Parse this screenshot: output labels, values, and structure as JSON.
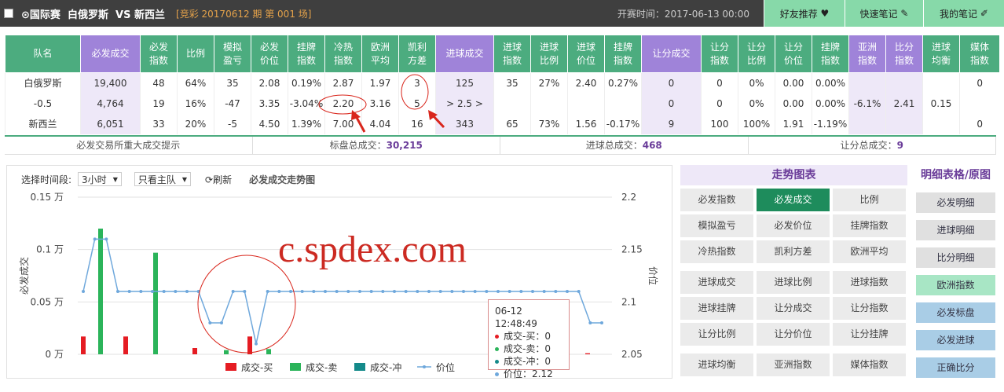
{
  "top": {
    "league": "⊙国际赛",
    "home": "白俄罗斯",
    "vs": "VS",
    "away": "新西兰",
    "issue": "[竞彩 20170612 期 第 001 场]",
    "open_time": "开赛时间：2017-06-13 00:00",
    "buttons": [
      "好友推荐",
      "快速笔记",
      "我的笔记"
    ]
  },
  "colors": {
    "header_green": "#4cac7f",
    "header_purple": "#9f83d9",
    "buy": "#e51c23",
    "sell": "#2bb45a",
    "hedge": "#148a8a",
    "price": "#6fa8dc"
  },
  "table": {
    "headers": [
      "队名",
      "必发成交",
      "必发指数",
      "比例",
      "模拟盈亏",
      "必发价位",
      "挂牌指数",
      "冷热指数",
      "欧洲平均",
      "凯利方差",
      "进球成交",
      "进球指数",
      "进球比例",
      "进球价位",
      "挂牌指数",
      "让分成交",
      "让分指数",
      "让分比例",
      "让分价位",
      "挂牌指数",
      "亚洲指数",
      "比分指数",
      "进球均衡",
      "媒体指数"
    ],
    "rows": [
      [
        "白俄罗斯",
        "19,400",
        "48",
        "64%",
        "35",
        "2.08",
        "0.19%",
        "2.87",
        "1.97",
        "3",
        "125",
        "35",
        "27%",
        "2.40",
        "0.27%",
        "0",
        "0",
        "0%",
        "0.00",
        "0.00%",
        "",
        "",
        "",
        "0"
      ],
      [
        "-0.5",
        "4,764",
        "19",
        "16%",
        "-47",
        "3.35",
        "-3.04%",
        "2.20",
        "3.16",
        "5",
        "> 2.5 >",
        "",
        "",
        "",
        "",
        "0",
        "0",
        "0%",
        "0.00",
        "0.00%",
        "-6.1%",
        "2.41",
        "0.15",
        ""
      ],
      [
        "新西兰",
        "6,051",
        "33",
        "20%",
        "-5",
        "4.50",
        "1.39%",
        "7.00",
        "4.04",
        "16",
        "343",
        "65",
        "73%",
        "1.56",
        "-0.17%",
        "9",
        "100",
        "100%",
        "1.91",
        "-1.19%",
        "",
        "",
        "",
        "0"
      ]
    ]
  },
  "summary": {
    "hint": "必发交易所重大成交提示",
    "total_label": "标盘总成交：",
    "total": "30,215",
    "goal_label": "进球总成交：",
    "goal": "468",
    "handicap_label": "让分总成交：",
    "handicap": "9"
  },
  "controls": {
    "period_label": "选择时间段:",
    "period": "3小时",
    "team": "只看主队",
    "refresh": "刷新",
    "title": "必发成交走势图"
  },
  "watermark": "c.spdex.com",
  "tooltip": {
    "time": "06-12 12:48:49",
    "buy": "成交-买：0",
    "sell": "成交-卖：0",
    "hedge": "成交-冲：0",
    "price": "价位：2.12"
  },
  "chart_data": {
    "type": "bar",
    "title": "",
    "ylabel": "必发成交",
    "y2label": "价位",
    "y_ticks": [
      "0.15 万",
      "0.1 万",
      "0.05 万",
      "0 万"
    ],
    "y2_ticks": [
      "2.2",
      "2.15",
      "2.1",
      "2.05"
    ],
    "ylim": [
      0,
      1500
    ],
    "y2lim": [
      2.05,
      2.2
    ],
    "legend": [
      "成交-买",
      "成交-卖",
      "成交-冲",
      "价位"
    ],
    "series": [
      {
        "name": "成交-买",
        "values": [
          170,
          170,
          60,
          170,
          10
        ]
      },
      {
        "name": "成交-卖",
        "values": [
          1200,
          970,
          40,
          50
        ]
      },
      {
        "name": "价位",
        "values": [
          2.11,
          2.16,
          2.16,
          2.11,
          2.11,
          2.11,
          2.11,
          2.11,
          2.11,
          2.11,
          2.11,
          2.08,
          2.08,
          2.11,
          2.11,
          2.06,
          2.11,
          2.11,
          2.11,
          2.11,
          2.11,
          2.11,
          2.11,
          2.11,
          2.11,
          2.11,
          2.11,
          2.11,
          2.11,
          2.11,
          2.11,
          2.11,
          2.11,
          2.11,
          2.11,
          2.11,
          2.11,
          2.11,
          2.11,
          2.11,
          2.11,
          2.11,
          2.11,
          2.11,
          2.08,
          2.08
        ]
      }
    ]
  },
  "trend_panel": {
    "title": "走势图表",
    "groups": [
      [
        "必发指数",
        "必发成交",
        "比例",
        "模拟盈亏",
        "必发价位",
        "挂牌指数",
        "冷热指数",
        "凯利方差",
        "欧洲平均"
      ],
      [
        "进球成交",
        "进球比例",
        "进球指数",
        "进球挂牌",
        "让分成交",
        "让分指数",
        "让分比例",
        "让分价位",
        "让分挂牌"
      ],
      [
        "进球均衡",
        "亚洲指数",
        "媒体指数"
      ]
    ],
    "active": "必发成交"
  },
  "detail_panel": {
    "title": "明细表格/原图",
    "items": [
      "必发明细",
      "进球明细",
      "比分明细",
      "欧洲指数",
      "必发标盘",
      "必发进球",
      "正确比分"
    ]
  }
}
